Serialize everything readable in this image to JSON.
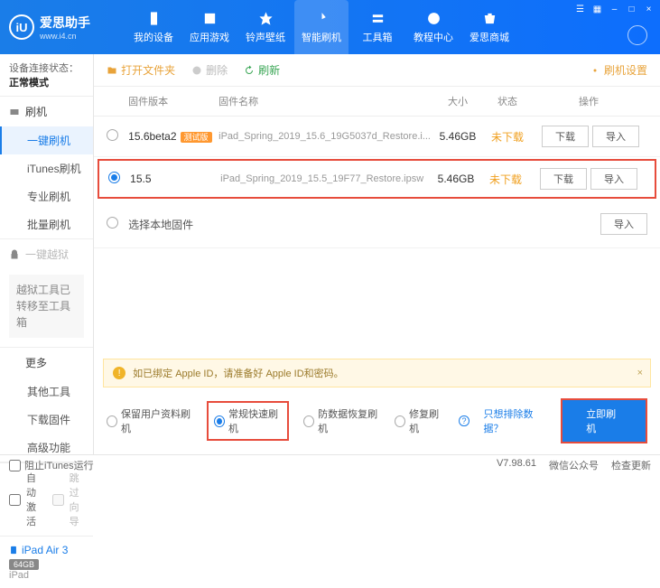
{
  "header": {
    "app_name": "爱思助手",
    "app_url": "www.i4.cn",
    "nav": [
      "我的设备",
      "应用游戏",
      "铃声壁纸",
      "智能刷机",
      "工具箱",
      "教程中心",
      "爱思商城"
    ],
    "active_nav": 3
  },
  "connection": {
    "label": "设备连接状态：",
    "value": "正常模式"
  },
  "sidebar": {
    "sections": [
      {
        "title": "刷机",
        "items": [
          "一键刷机",
          "iTunes刷机",
          "专业刷机",
          "批量刷机"
        ],
        "active": 0
      },
      {
        "title": "一键越狱",
        "tip": "越狱工具已转移至工具箱"
      },
      {
        "title": "更多",
        "items": [
          "其他工具",
          "下载固件",
          "高级功能"
        ]
      }
    ],
    "auto_activate": "自动激活",
    "skip_guide": "跳过向导",
    "device": {
      "name": "iPad Air 3",
      "storage": "64GB",
      "model": "iPad"
    }
  },
  "toolbar": {
    "open_folder": "打开文件夹",
    "delete": "删除",
    "refresh": "刷新",
    "settings": "刷机设置"
  },
  "columns": {
    "version": "固件版本",
    "name": "固件名称",
    "size": "大小",
    "status": "状态",
    "ops": "操作"
  },
  "rows": [
    {
      "selected": false,
      "version": "15.6beta2",
      "beta": "测试版",
      "name": "iPad_Spring_2019_15.6_19G5037d_Restore.i...",
      "size": "5.46GB",
      "status": "未下载"
    },
    {
      "selected": true,
      "version": "15.5",
      "name": "iPad_Spring_2019_15.5_19F77_Restore.ipsw",
      "size": "5.46GB",
      "status": "未下载"
    }
  ],
  "local_row": "选择本地固件",
  "ops": {
    "download": "下载",
    "import": "导入"
  },
  "warning": "如已绑定 Apple ID，请准备好 Apple ID和密码。",
  "modes": {
    "opts": [
      "保留用户资料刷机",
      "常规快速刷机",
      "防数据恢复刷机",
      "修复刷机"
    ],
    "selected": 1,
    "exclude": "只想排除数据？",
    "flash": "立即刷机"
  },
  "footer": {
    "block_itunes": "阻止iTunes运行",
    "version": "V7.98.61",
    "wechat": "微信公众号",
    "check_update": "检查更新"
  }
}
